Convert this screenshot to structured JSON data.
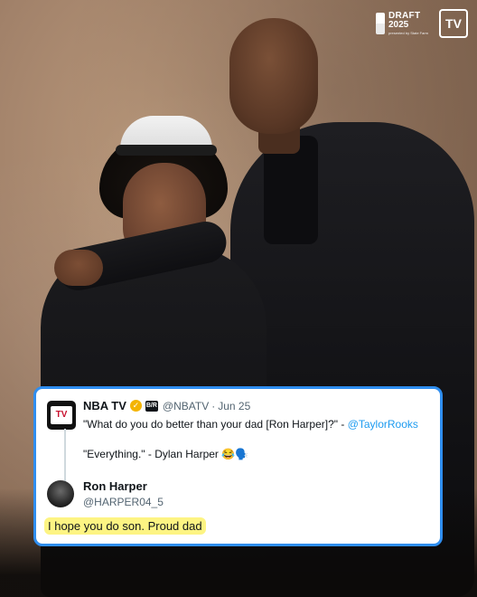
{
  "photo": {
    "description_icon": "photo-icon"
  },
  "logos": {
    "draft_word": "DRAFT",
    "draft_year": "2025",
    "draft_sub": "presented by State Farm",
    "tv_label": "TV"
  },
  "tweet": {
    "account_name": "NBA TV",
    "badge_label": "B/R",
    "handle": "@NBATV",
    "separator": "·",
    "date": "Jun 25",
    "quote_text": "\"What do you do better than your dad [Ron Harper]?\" -",
    "quote_mention": "@TaylorRooks",
    "answer_text": "\"Everything.\" - Dylan Harper 😂🗣️",
    "avatar_label": "TV"
  },
  "reply": {
    "account_name": "Ron Harper",
    "handle": "@HARPER04_5",
    "text": "I hope you do son. Proud dad"
  },
  "colors": {
    "card_border": "#2f8ef0",
    "mention": "#1d9bf0",
    "highlight": "#fdf483"
  }
}
